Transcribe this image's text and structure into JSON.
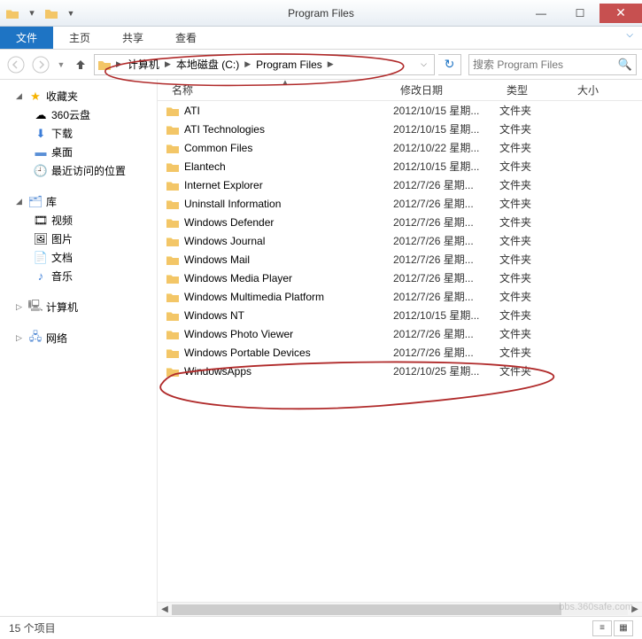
{
  "window": {
    "title": "Program Files"
  },
  "ribbon": {
    "file": "文件",
    "home": "主页",
    "share": "共享",
    "view": "查看"
  },
  "breadcrumb": {
    "items": [
      "计算机",
      "本地磁盘 (C:)",
      "Program Files"
    ]
  },
  "search": {
    "placeholder": "搜索 Program Files"
  },
  "columns": {
    "name": "名称",
    "date": "修改日期",
    "type": "类型",
    "size": "大小"
  },
  "sidebar": {
    "fav": {
      "label": "收藏夹",
      "items": [
        "360云盘",
        "下载",
        "桌面",
        "最近访问的位置"
      ]
    },
    "lib": {
      "label": "库",
      "items": [
        "视频",
        "图片",
        "文档",
        "音乐"
      ]
    },
    "computer": "计算机",
    "network": "网络"
  },
  "files": [
    {
      "name": "ATI",
      "date": "2012/10/15 星期...",
      "type": "文件夹"
    },
    {
      "name": "ATI Technologies",
      "date": "2012/10/15 星期...",
      "type": "文件夹"
    },
    {
      "name": "Common Files",
      "date": "2012/10/22 星期...",
      "type": "文件夹"
    },
    {
      "name": "Elantech",
      "date": "2012/10/15 星期...",
      "type": "文件夹"
    },
    {
      "name": "Internet Explorer",
      "date": "2012/7/26 星期...",
      "type": "文件夹"
    },
    {
      "name": "Uninstall Information",
      "date": "2012/7/26 星期...",
      "type": "文件夹"
    },
    {
      "name": "Windows Defender",
      "date": "2012/7/26 星期...",
      "type": "文件夹"
    },
    {
      "name": "Windows Journal",
      "date": "2012/7/26 星期...",
      "type": "文件夹"
    },
    {
      "name": "Windows Mail",
      "date": "2012/7/26 星期...",
      "type": "文件夹"
    },
    {
      "name": "Windows Media Player",
      "date": "2012/7/26 星期...",
      "type": "文件夹"
    },
    {
      "name": "Windows Multimedia Platform",
      "date": "2012/7/26 星期...",
      "type": "文件夹"
    },
    {
      "name": "Windows NT",
      "date": "2012/10/15 星期...",
      "type": "文件夹"
    },
    {
      "name": "Windows Photo Viewer",
      "date": "2012/7/26 星期...",
      "type": "文件夹"
    },
    {
      "name": "Windows Portable Devices",
      "date": "2012/7/26 星期...",
      "type": "文件夹"
    },
    {
      "name": "WindowsApps",
      "date": "2012/10/25 星期...",
      "type": "文件夹"
    }
  ],
  "status": {
    "count": "15 个项目"
  },
  "watermark": "bbs.360safe.com"
}
